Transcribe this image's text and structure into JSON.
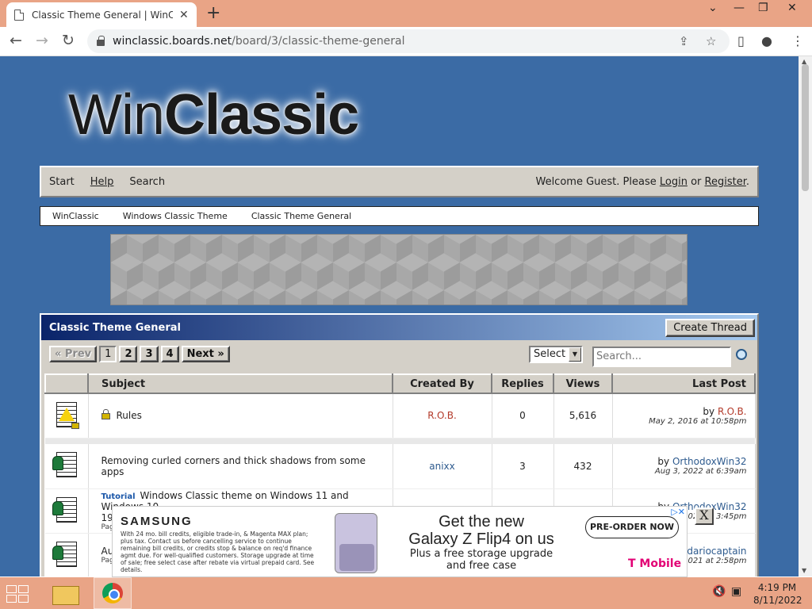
{
  "browser": {
    "tab_title": "Classic Theme General | WinClassic",
    "url_host": "winclassic.boards.net",
    "url_path": "/board/3/classic-theme-general"
  },
  "site": {
    "logo_light": "Win",
    "logo_bold": "Classic",
    "nav": {
      "start": "Start",
      "help": "Help",
      "search": "Search"
    },
    "welcome_prefix": "Welcome Guest. Please ",
    "login": "Login",
    "or": " or ",
    "register": "Register",
    "period": ".",
    "breadcrumbs": [
      "WinClassic",
      "Windows Classic Theme",
      "Classic Theme General"
    ]
  },
  "board": {
    "title": "Classic Theme General",
    "create_thread": "Create Thread",
    "pager": {
      "prev": "« Prev",
      "pages": [
        "1",
        "2",
        "3",
        "4"
      ],
      "next": "Next »"
    },
    "select_value": "Select",
    "search_placeholder": "Search...",
    "columns": {
      "subject": "Subject",
      "created_by": "Created By",
      "replies": "Replies",
      "views": "Views",
      "last_post": "Last Post"
    },
    "threads": [
      {
        "subject": "Rules",
        "creator": "R.O.B.",
        "replies": "0",
        "views": "5,616",
        "by": "by ",
        "last_user": "R.O.B.",
        "last_date": "May 2, 2016 at 10:58pm"
      },
      {
        "subject": "Removing curled corners and thick shadows from some apps",
        "creator": "anixx",
        "replies": "3",
        "views": "432",
        "by": "by ",
        "last_user": "OrthodoxWin32",
        "last_date": "Aug 3, 2022 at 6:39am"
      },
      {
        "tag": "Tutorial",
        "subject": "Windows Classic theme on Windows 11 and Windows 10",
        "subject_line2": "19",
        "pages_prefix": "Pag",
        "by": "by ",
        "last_user": "OrthodoxWin32",
        "last_date": "2022 at 3:45pm"
      },
      {
        "subject": "Au",
        "pages_prefix": "Pag",
        "by": "y ",
        "last_user": "dariocaptain",
        "last_date": "2021 at 2:58pm"
      }
    ]
  },
  "ad": {
    "brand": "SAMSUNG",
    "fine_print": "With 24 mo. bill credits, eligible trade-in, & Magenta MAX plan; plus tax. Contact us before cancelling service to continue remaining bill credits, or credits stop & balance on req'd finance agmt due. For well-qualified customers. Storage upgrade at time of sale; free select case after rebate via virtual prepaid card. See details.",
    "headline1": "Get the new",
    "headline2": "Galaxy Z Flip4 on us",
    "sub1": "Plus a free storage upgrade",
    "sub2": "and free case",
    "cta": "PRE-ORDER NOW",
    "carrier": "T Mobile",
    "close": "X"
  },
  "taskbar": {
    "time": "4:19 PM",
    "date": "8/11/2022"
  }
}
